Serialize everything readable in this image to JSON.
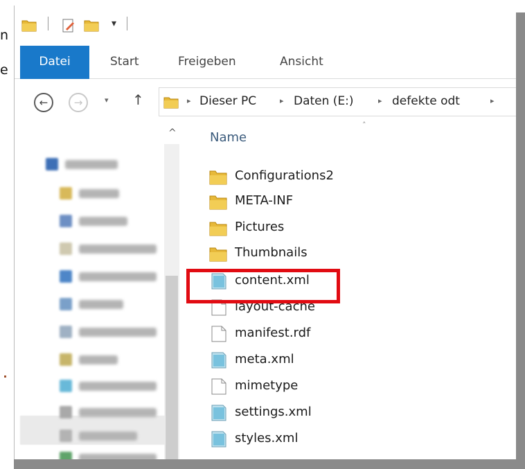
{
  "background_fragments": [
    "n",
    "e"
  ],
  "quick_access": {
    "icons": [
      "folder-icon",
      "properties-icon",
      "new-folder-icon",
      "customize-dropdown-icon"
    ],
    "dropdown_glyph": "▾"
  },
  "ribbon": {
    "tabs": [
      {
        "label": "Datei",
        "active": true
      },
      {
        "label": "Start"
      },
      {
        "label": "Freigeben"
      },
      {
        "label": "Ansicht"
      }
    ]
  },
  "address_bar": {
    "breadcrumbs": [
      "Dieser PC",
      "Daten (E:)",
      "defekte odt"
    ],
    "separator": "▸"
  },
  "navigation": {
    "back": "←",
    "forward": "→",
    "history": "▾",
    "up": "↑"
  },
  "file_list": {
    "column_header": "Name",
    "sort_indicator": "˄",
    "items": [
      {
        "name": "Configurations2",
        "type": "folder"
      },
      {
        "name": "META-INF",
        "type": "folder"
      },
      {
        "name": "Pictures",
        "type": "folder"
      },
      {
        "name": "Thumbnails",
        "type": "folder"
      },
      {
        "name": "content.xml",
        "type": "xml",
        "highlighted": true
      },
      {
        "name": "layout-cache",
        "type": "file"
      },
      {
        "name": "manifest.rdf",
        "type": "file"
      },
      {
        "name": "meta.xml",
        "type": "xml"
      },
      {
        "name": "mimetype",
        "type": "file"
      },
      {
        "name": "settings.xml",
        "type": "xml"
      },
      {
        "name": "styles.xml",
        "type": "xml"
      }
    ]
  },
  "colors": {
    "file_tab": "#1979ca",
    "highlight_box": "#e10b12",
    "folder": "#e7b93a",
    "xml_icon": "#5fb6d6"
  }
}
